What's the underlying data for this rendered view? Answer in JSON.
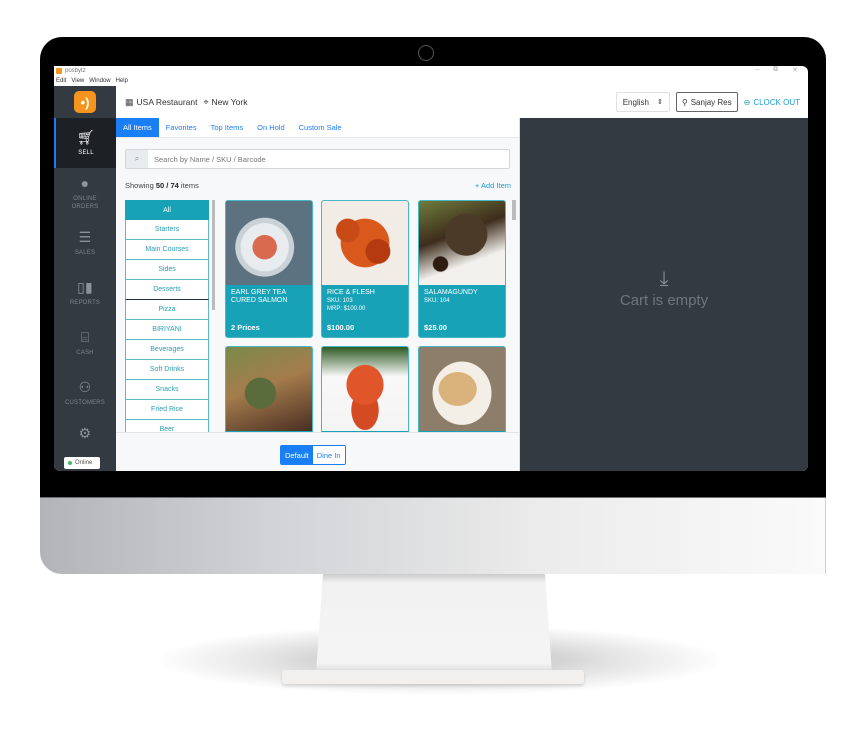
{
  "window": {
    "app_title": "posbytz",
    "menu": [
      "Edit",
      "View",
      "Window",
      "Help"
    ],
    "controls": [
      "–",
      "⧉",
      "✕"
    ]
  },
  "header": {
    "store_icon": "store-icon",
    "store_name": "USA Restaurant",
    "location_icon": "map-pin-icon",
    "location": "New York",
    "language": "English",
    "user": "Sanjay Res",
    "clock_out": "CLOCK OUT"
  },
  "sidebar": {
    "items": [
      {
        "label": "SELL",
        "icon": "cart-icon",
        "active": true
      },
      {
        "label": "ONLINE ORDERS",
        "icon": "globe-icon"
      },
      {
        "label": "SALES",
        "icon": "checklist-icon"
      },
      {
        "label": "REPORTS",
        "icon": "bar-chart-icon"
      },
      {
        "label": "CASH",
        "icon": "cash-register-icon"
      },
      {
        "label": "CUSTOMERS",
        "icon": "users-icon"
      },
      {
        "label": "",
        "icon": "gear-icon"
      }
    ],
    "status": "Online",
    "status_color": "#40c057"
  },
  "tabs": [
    "All Items",
    "Favorites",
    "Top Items",
    "On Hold",
    "Custom Sale"
  ],
  "search": {
    "placeholder": "Search by Name / SKU / Barcode"
  },
  "showing": {
    "prefix": "Showing",
    "count": "50 / 74",
    "suffix": "items"
  },
  "add_item": "+ Add Item",
  "categories": [
    "All",
    "Starters",
    "Main Courses",
    "Sides",
    "Desserts",
    "Pizza",
    "BIRIYANI",
    "Beverages",
    "Soft Drinks",
    "Snacks",
    "Fried Rice",
    "Beer"
  ],
  "products": [
    {
      "name": "EARL GREY TEA CURED SALMON",
      "sku": "",
      "mrp": "",
      "price": "2 Prices"
    },
    {
      "name": "RICE & FLESH",
      "sku": "SKU: 103",
      "mrp": "MRP: $100.00",
      "price": "$100.00"
    },
    {
      "name": "SALAMAGUNDY",
      "sku": "SKU: 104",
      "mrp": "",
      "price": "$25.00"
    },
    {
      "name": "",
      "sku": "",
      "mrp": "",
      "price": ""
    },
    {
      "name": "",
      "sku": "",
      "mrp": "",
      "price": ""
    },
    {
      "name": "",
      "sku": "",
      "mrp": "",
      "price": ""
    }
  ],
  "order_type": {
    "options": [
      "Default",
      "Dine In"
    ],
    "selected": "Default"
  },
  "cart": {
    "empty_text": "Cart is empty"
  },
  "colors": {
    "accent": "#1a7ff5",
    "teal": "#17a2b8",
    "brand": "#f7941d",
    "sidebar": "#343a42"
  }
}
